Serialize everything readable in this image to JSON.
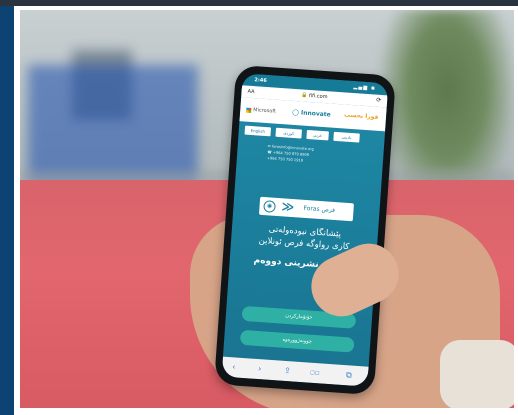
{
  "phone": {
    "status_time": "2:46",
    "status_icons": "▂▄▆ ◉",
    "url": "🔒 fifi.com",
    "url_aa": "AA",
    "url_refresh": "⟳",
    "logos": {
      "microsoft": "Microsoft",
      "center": "◯ Innovate",
      "right": "فورا بحسب"
    },
    "languages": [
      "English",
      "کوردی",
      "عربي",
      "بادینی"
    ],
    "contact": [
      "✉ forasinfo@innovate.org",
      "☎ +964 750 879 8909",
      "+964 750 750 1919"
    ],
    "brand": {
      "icon": "◉",
      "chevron": "≫",
      "name": "Foras فرص"
    },
    "headline": [
      "پێشانگای نیودەولەتی",
      "کاری رواوگە فرص ئونلاین"
    ],
    "subhead": "تکو ئێ نشرینی دووەم",
    "buttons": {
      "register": "خۆتۆمارکردن",
      "login": "چوونەژوورەوە"
    },
    "nav_icons": [
      "‹",
      "›",
      "⇪",
      "▢▢",
      "⧉"
    ]
  },
  "colors": {
    "screen": "#1b7f9c",
    "button": "#2fb0a4",
    "ground": "#e2666d",
    "left_panel": "#0d4373"
  }
}
